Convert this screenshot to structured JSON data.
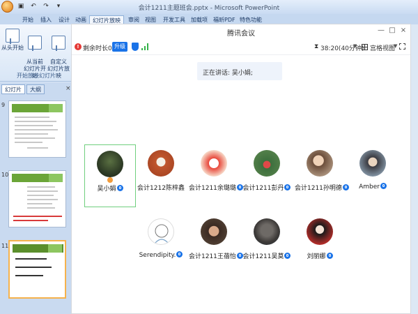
{
  "powerpoint": {
    "window_title": "会计1211主题班会.pptx - Microsoft PowerPoint",
    "ribbon_tabs": [
      "开始",
      "插入",
      "设计",
      "动画",
      "幻灯片放映",
      "审阅",
      "视图",
      "开发工具",
      "加载项",
      "福昕PDF",
      "特色功能"
    ],
    "active_tab": "幻灯片放映",
    "ribbon_buttons": [
      {
        "label": "从头开始"
      },
      {
        "label": "从当前\n幻灯片开始"
      },
      {
        "label": "自定义\n幻灯片放映"
      }
    ],
    "ribbon_group_label": "开始放映幻灯片",
    "pane_tabs": [
      "幻灯片",
      "大纲"
    ],
    "pane_close": "×",
    "slide_numbers": [
      "9",
      "10",
      "11"
    ],
    "thumb_title": "二、毕业生文明离校注意事项",
    "thumb_title_3": "三、毕业感想"
  },
  "meeting": {
    "title": "腾讯会议",
    "window_controls": [
      "—",
      "□",
      "×"
    ],
    "remaining_label": "剩余时长01:41",
    "upgrade_label": "升级",
    "timer": "38:20(40分钟)",
    "view_label": "宫格视图",
    "speaking_label": "正在讲话: 吴小娟;",
    "participants": [
      {
        "name": "吴小娟",
        "mic": true,
        "active": true
      },
      {
        "name": "会计1212陈梓鑫",
        "mic": false
      },
      {
        "name": "会计1211余璐璐",
        "mic": true
      },
      {
        "name": "会计1211彭丹",
        "mic": true
      },
      {
        "name": "会计1211孙明德",
        "mic": true
      },
      {
        "name": "Amber",
        "mic": true
      },
      {
        "name": "Serendipity.",
        "mic": true
      },
      {
        "name": "会计1211王蓓怡",
        "mic": true
      },
      {
        "name": "会计1211吴莫",
        "mic": true
      },
      {
        "name": "刘丽娜",
        "mic": true
      }
    ]
  },
  "colors": {
    "accent_blue": "#1a73e8",
    "active_border": "#6fcf7d",
    "warn_red": "#e53935",
    "slide_green": "#6ba538"
  },
  "icons": [
    "warning-icon",
    "shield-icon",
    "signal-icon",
    "hourglass-icon",
    "grid-view-icon",
    "fullscreen-icon",
    "mic-icon",
    "slide-panel-handle-icon"
  ]
}
